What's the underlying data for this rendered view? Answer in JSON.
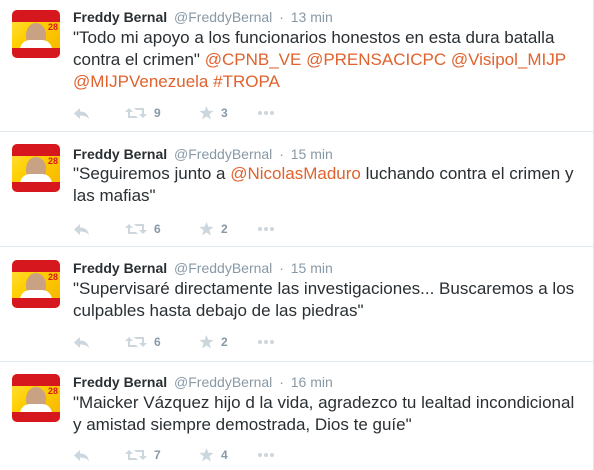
{
  "tweets": [
    {
      "fullname": "Freddy Bernal",
      "username": "@FreddyBernal",
      "time": "13 min",
      "text_parts": [
        {
          "t": "\"Todo mi apoyo a los funcionarios honestos en esta dura batalla contra el crimen\" ",
          "link": false
        },
        {
          "t": "@CPNB_VE",
          "link": true
        },
        {
          "t": " ",
          "link": false
        },
        {
          "t": "@PRENSACICPC",
          "link": true
        },
        {
          "t": " ",
          "link": false
        },
        {
          "t": "@Visipol_MIJP",
          "link": true
        },
        {
          "t": " ",
          "link": false
        },
        {
          "t": "@MIJPVenezuela",
          "link": true
        },
        {
          "t": " ",
          "link": false
        },
        {
          "t": "#TROPA",
          "link": true
        }
      ],
      "retweets": "9",
      "favorites": "3"
    },
    {
      "fullname": "Freddy Bernal",
      "username": "@FreddyBernal",
      "time": "15 min",
      "text_parts": [
        {
          "t": "\"Seguiremos junto a ",
          "link": false
        },
        {
          "t": "@NicolasMaduro",
          "link": true
        },
        {
          "t": " luchando contra el crimen y las mafias\"",
          "link": false
        }
      ],
      "retweets": "6",
      "favorites": "2"
    },
    {
      "fullname": "Freddy Bernal",
      "username": "@FreddyBernal",
      "time": "15 min",
      "text_parts": [
        {
          "t": "\"Supervisaré directamente las investigaciones... Buscaremos a los culpables hasta debajo de las piedras\"",
          "link": false
        }
      ],
      "retweets": "6",
      "favorites": "2"
    },
    {
      "fullname": "Freddy Bernal",
      "username": "@FreddyBernal",
      "time": "16 min",
      "text_parts": [
        {
          "t": "\"Maicker Vázquez hijo d la vida, agradezco tu lealtad incondicional y amistad siempre demostrada, Dios te guíe\"",
          "link": false
        }
      ],
      "retweets": "7",
      "favorites": "4"
    }
  ],
  "avatar_number": "28",
  "colors": {
    "link": "#e0622d",
    "muted": "#8899a6",
    "text": "#292f33",
    "border": "#e1e8ed"
  },
  "icons": [
    "reply-icon",
    "retweet-icon",
    "favorite-icon",
    "more-icon"
  ]
}
